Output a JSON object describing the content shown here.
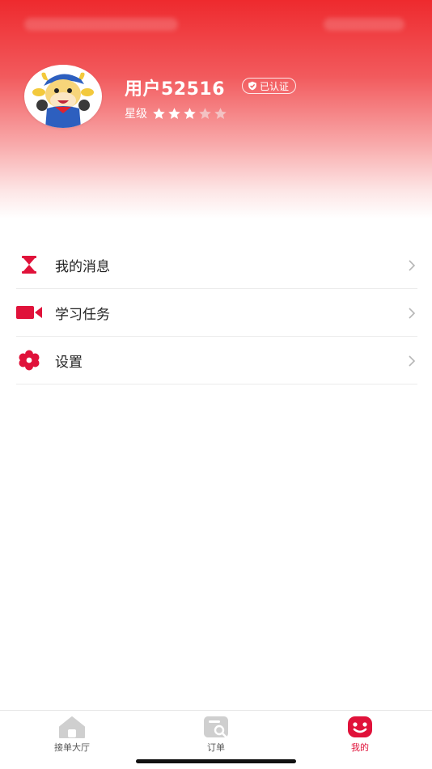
{
  "profile": {
    "username": "用户52516",
    "verified_label": "已认证",
    "rating_label": "星级",
    "rating": 3,
    "rating_max": 5
  },
  "menu": [
    {
      "label": "我的消息",
      "icon": "hourglass-icon"
    },
    {
      "label": "学习任务",
      "icon": "video-camera-icon"
    },
    {
      "label": "设置",
      "icon": "gear-flower-icon"
    }
  ],
  "tabbar": {
    "tabs": [
      {
        "label": "接单大厅",
        "icon": "home-icon",
        "active": false
      },
      {
        "label": "订单",
        "icon": "order-icon",
        "active": false
      },
      {
        "label": "我的",
        "icon": "smiley-icon",
        "active": true
      }
    ]
  },
  "colors": {
    "accent": "#e0123a",
    "header_top": "#ee2a2e",
    "star_filled": "#ffffff",
    "star_empty": "#f3c2c3"
  }
}
